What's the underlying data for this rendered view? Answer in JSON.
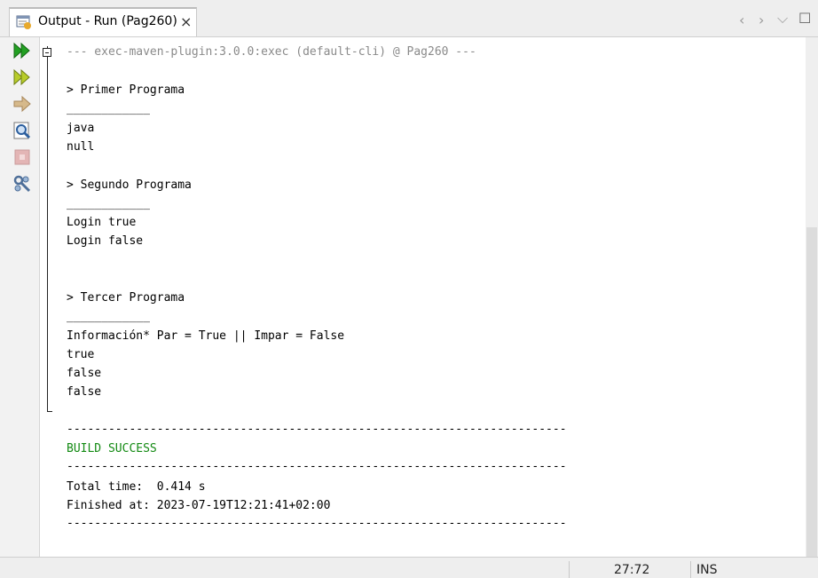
{
  "tab": {
    "title": "Output - Run (Pag260)",
    "close": "×"
  },
  "nav": {
    "left": "‹",
    "right": "›",
    "down": "⌵",
    "maximize": "☐"
  },
  "toolbar": [
    {
      "name": "rerun-icon",
      "color": "#1f9e1f"
    },
    {
      "name": "rerun-with-params-icon",
      "color": "#a5c41a"
    },
    {
      "name": "stop-arrow-icon",
      "color": "#c7a36a"
    },
    {
      "name": "find-icon",
      "color": "#2c6fb7"
    },
    {
      "name": "stop-icon",
      "color": "#d9a6a6"
    },
    {
      "name": "settings-icon",
      "color": "#5a7ea8"
    }
  ],
  "output": {
    "header": "--- exec-maven-plugin:3.0.0:exec (default-cli) @ Pag260 ---",
    "lines": [
      "> Primer Programa",
      "____________",
      "java",
      "null",
      "> Segundo Programa",
      "____________",
      "Login true",
      "Login false",
      "> Tercer Programa",
      "____________",
      "Información* Par = True || Impar = False",
      "true",
      "false",
      "false",
      "------------------------------------------------------------------------",
      "BUILD SUCCESS",
      "------------------------------------------------------------------------",
      "Total time:  0.414 s",
      "Finished at: 2023-07-19T12:21:41+02:00",
      "------------------------------------------------------------------------"
    ]
  },
  "status": {
    "position": "27:72",
    "mode": "INS"
  }
}
